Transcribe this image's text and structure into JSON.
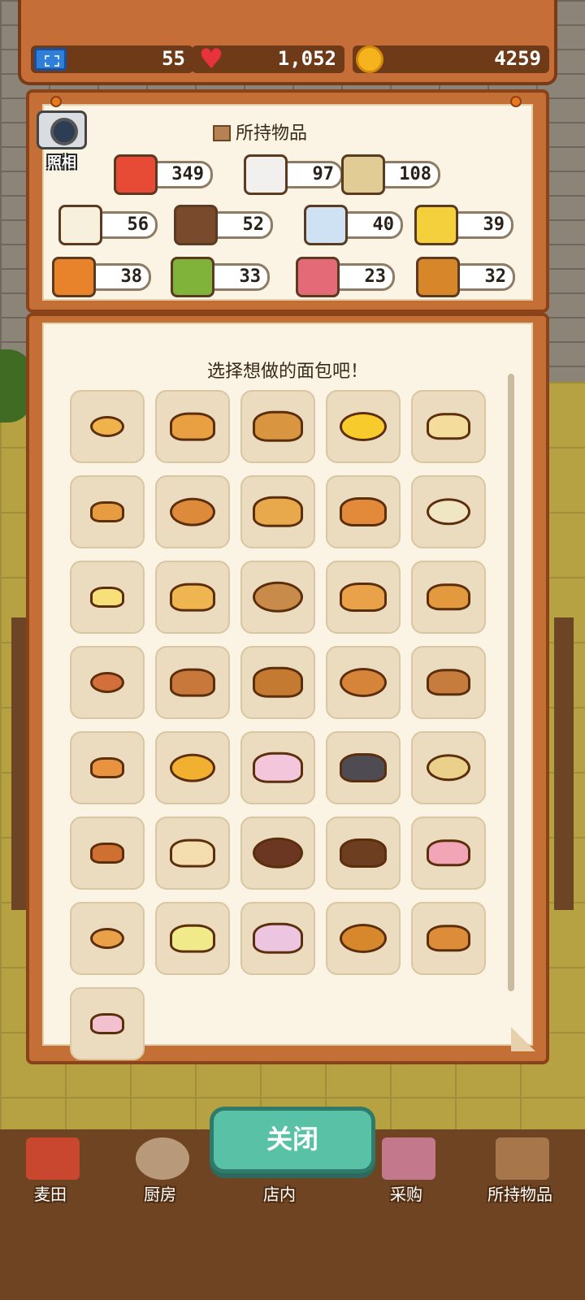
{
  "status_bar": {
    "tickets": "55",
    "hearts": "1,052",
    "coins": "4259"
  },
  "camera": {
    "label": "照相"
  },
  "inventory": {
    "title": "所持物品",
    "items": [
      {
        "name": "flour-bag",
        "count": "349",
        "color": "#e84b35"
      },
      {
        "name": "milk-bottle",
        "count": "97",
        "color": "#f2f0ee"
      },
      {
        "name": "butter-block",
        "count": "108",
        "color": "#e2cc95"
      },
      {
        "name": "sugar-jar",
        "count": "56",
        "color": "#f7f0dc"
      },
      {
        "name": "chocolate-bar",
        "count": "52",
        "color": "#7a4a2c"
      },
      {
        "name": "salt-pile",
        "count": "40",
        "color": "#cfe2f3"
      },
      {
        "name": "cheese",
        "count": "39",
        "color": "#f4d13c"
      },
      {
        "name": "fruit-basket",
        "count": "38",
        "color": "#e8832b"
      },
      {
        "name": "vegetable-basket",
        "count": "33",
        "color": "#7fb33a"
      },
      {
        "name": "meat",
        "count": "23",
        "color": "#e46a78"
      },
      {
        "name": "spices",
        "count": "32",
        "color": "#d7862a"
      }
    ]
  },
  "bread_menu": {
    "prompt": "选择想做的面包吧！",
    "breads": [
      "#f0b24a",
      "#e9a043",
      "#d9953f",
      "#f8cb2c",
      "#f3dc9c",
      "#e89c42",
      "#dd8a3a",
      "#e7a94c",
      "#e2893a",
      "#f1e6c4",
      "#f7e07a",
      "#efb551",
      "#c98b4a",
      "#e9a24a",
      "#e39a3e",
      "#d36f3b",
      "#c9783b",
      "#c47a30",
      "#d5843a",
      "#c67c3c",
      "#e8933f",
      "#f2b030",
      "#f3c6dc",
      "#4e4b53",
      "#ead08a",
      "#cf6f31",
      "#f4deb0",
      "#6b3722",
      "#6d3e20",
      "#f3a5b8",
      "#eaa049",
      "#f0ea8a",
      "#ecc6e0",
      "#d7882c",
      "#dd8c39",
      "#f2c0cf"
    ]
  },
  "close_button": {
    "label": "关闭"
  },
  "bottom_nav": [
    {
      "label": "麦田"
    },
    {
      "label": "厨房"
    },
    {
      "label": "店内"
    },
    {
      "label": "采购"
    },
    {
      "label": "所持物品"
    }
  ]
}
